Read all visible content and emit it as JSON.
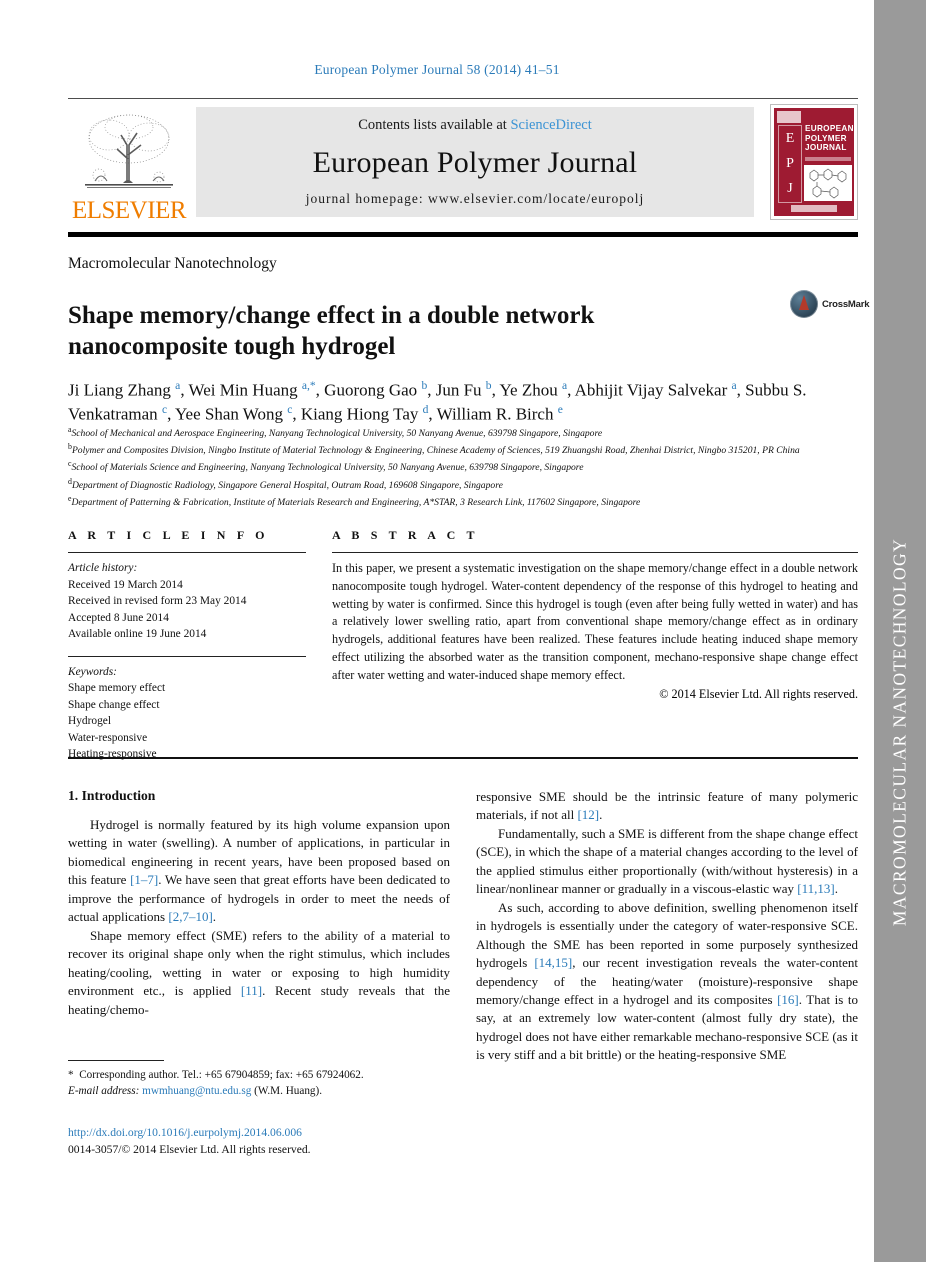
{
  "side_band": {
    "text": "MACROMOLECULAR NANOTECHNOLOGY",
    "bg_color": "#9a9a9a",
    "text_color": "#ffffff"
  },
  "running_head": "European Polymer Journal 58 (2014) 41–51",
  "masthead": {
    "publisher": "ELSEVIER",
    "contents_prefix": "Contents lists available at ",
    "contents_link": "ScienceDirect",
    "journal_title": "European Polymer Journal",
    "homepage": "journal homepage: www.elsevier.com/locate/europolj",
    "cover": {
      "line1": "EUROPEAN",
      "line2": "POLYMER",
      "line3": "JOURNAL",
      "letters": [
        "E",
        "P",
        "J"
      ],
      "bg_color": "#9e1b32"
    }
  },
  "section_head": "Macromolecular Nanotechnology",
  "title": "Shape memory/change effect in a double network nanocomposite tough hydrogel",
  "crossmark": {
    "label": "CrossMark"
  },
  "authors_html": "Ji Liang Zhang <sup>a</sup>, Wei Min Huang <sup>a,<span class=\"star\">*</span></sup>, Guorong Gao <sup>b</sup>, Jun Fu <sup>b</sup>, Ye Zhou <sup>a</sup>, Abhijit Vijay Salvekar <sup>a</sup>, Subbu S. Venkatraman <sup>c</sup>, Yee Shan Wong <sup>c</sup>, Kiang Hiong Tay <sup>d</sup>, William R. Birch <sup>e</sup>",
  "affiliations": [
    {
      "mark": "a",
      "text": "School of Mechanical and Aerospace Engineering, Nanyang Technological University, 50 Nanyang Avenue, 639798 Singapore, Singapore"
    },
    {
      "mark": "b",
      "text": "Polymer and Composites Division, Ningbo Institute of Material Technology & Engineering, Chinese Academy of Sciences, 519 Zhuangshi Road, Zhenhai District, Ningbo 315201, PR China"
    },
    {
      "mark": "c",
      "text": "School of Materials Science and Engineering, Nanyang Technological University, 50 Nanyang Avenue, 639798 Singapore, Singapore"
    },
    {
      "mark": "d",
      "text": "Department of Diagnostic Radiology, Singapore General Hospital, Outram Road, 169608 Singapore, Singapore"
    },
    {
      "mark": "e",
      "text": "Department of Patterning & Fabrication, Institute of Materials Research and Engineering, A*STAR, 3 Research Link, 117602 Singapore, Singapore"
    }
  ],
  "article_info": {
    "heading": "A R T I C L E   I N F O",
    "history_label": "Article history:",
    "history": [
      "Received 19 March 2014",
      "Received in revised form 23 May 2014",
      "Accepted 8 June 2014",
      "Available online 19 June 2014"
    ],
    "keywords_label": "Keywords:",
    "keywords": [
      "Shape memory effect",
      "Shape change effect",
      "Hydrogel",
      "Water-responsive",
      "Heating-responsive"
    ]
  },
  "abstract": {
    "heading": "A B S T R A C T",
    "text": "In this paper, we present a systematic investigation on the shape memory/change effect in a double network nanocomposite tough hydrogel. Water-content dependency of the response of this hydrogel to heating and wetting by water is confirmed. Since this hydrogel is tough (even after being fully wetted in water) and has a relatively lower swelling ratio, apart from conventional shape memory/change effect as in ordinary hydrogels, additional features have been realized. These features include heating induced shape memory effect utilizing the absorbed water as the transition component, mechano-responsive shape change effect after water wetting and water-induced shape memory effect.",
    "copyright": "© 2014 Elsevier Ltd. All rights reserved."
  },
  "body": {
    "intro_heading": "1. Introduction",
    "left_paragraphs_html": [
      "Hydrogel is normally featured by its high volume expansion upon wetting in water (swelling). A number of applications, in particular in biomedical engineering in recent years, have been proposed based on this feature <span class=\"ref\">[1–7]</span>. We have seen that great efforts have been dedicated to improve the performance of hydrogels in order to meet the needs of actual applications <span class=\"ref\">[2,7–10]</span>.",
      "Shape memory effect (SME) refers to the ability of a material to recover its original shape only when the right stimulus, which includes heating/cooling, wetting in water or exposing to high humidity environment etc., is applied <span class=\"ref\">[11]</span>. Recent study reveals that the heating/chemo-"
    ],
    "right_paragraphs_html": [
      "responsive SME should be the intrinsic feature of many polymeric materials, if not all <span class=\"ref\">[12]</span>.",
      "Fundamentally, such a SME is different from the shape change effect (SCE), in which the shape of a material changes according to the level of the applied stimulus either proportionally (with/without hysteresis) in a linear/nonlinear manner or gradually in a viscous-elastic way <span class=\"ref\">[11,13]</span>.",
      "As such, according to above definition, swelling phenomenon itself in hydrogels is essentially under the category of water-responsive SCE. Although the SME has been reported in some purposely synthesized hydrogels <span class=\"ref\">[14,15]</span>, our recent investigation reveals the water-content dependency of the heating/water (moisture)-responsive shape memory/change effect in a hydrogel and its composites <span class=\"ref\">[16]</span>. That is to say, at an extremely low water-content (almost fully dry state), the hydrogel does not have either remarkable mechano-responsive SCE (as it is very stiff and a bit brittle) or the heating-responsive SME"
    ]
  },
  "footnote": {
    "corresponding_html": "<span class=\"ast\">*</span>&nbsp; Corresponding author. Tel.: +65 67904859; fax: +65 67924062.",
    "email_label": "E-mail address:",
    "email": "mwmhuang@ntu.edu.sg",
    "email_owner": "(W.M. Huang)."
  },
  "doi_block": {
    "doi_url": "http://dx.doi.org/10.1016/j.eurpolymj.2014.06.006",
    "issn_line": "0014-3057/© 2014 Elsevier Ltd. All rights reserved."
  },
  "colors": {
    "link_blue": "#2b7bb9",
    "sciencedirect_blue": "#3b93d4",
    "elsevier_orange": "#ef7d00",
    "cover_red": "#9e1b32",
    "band_gray": "#9a9a9a"
  }
}
